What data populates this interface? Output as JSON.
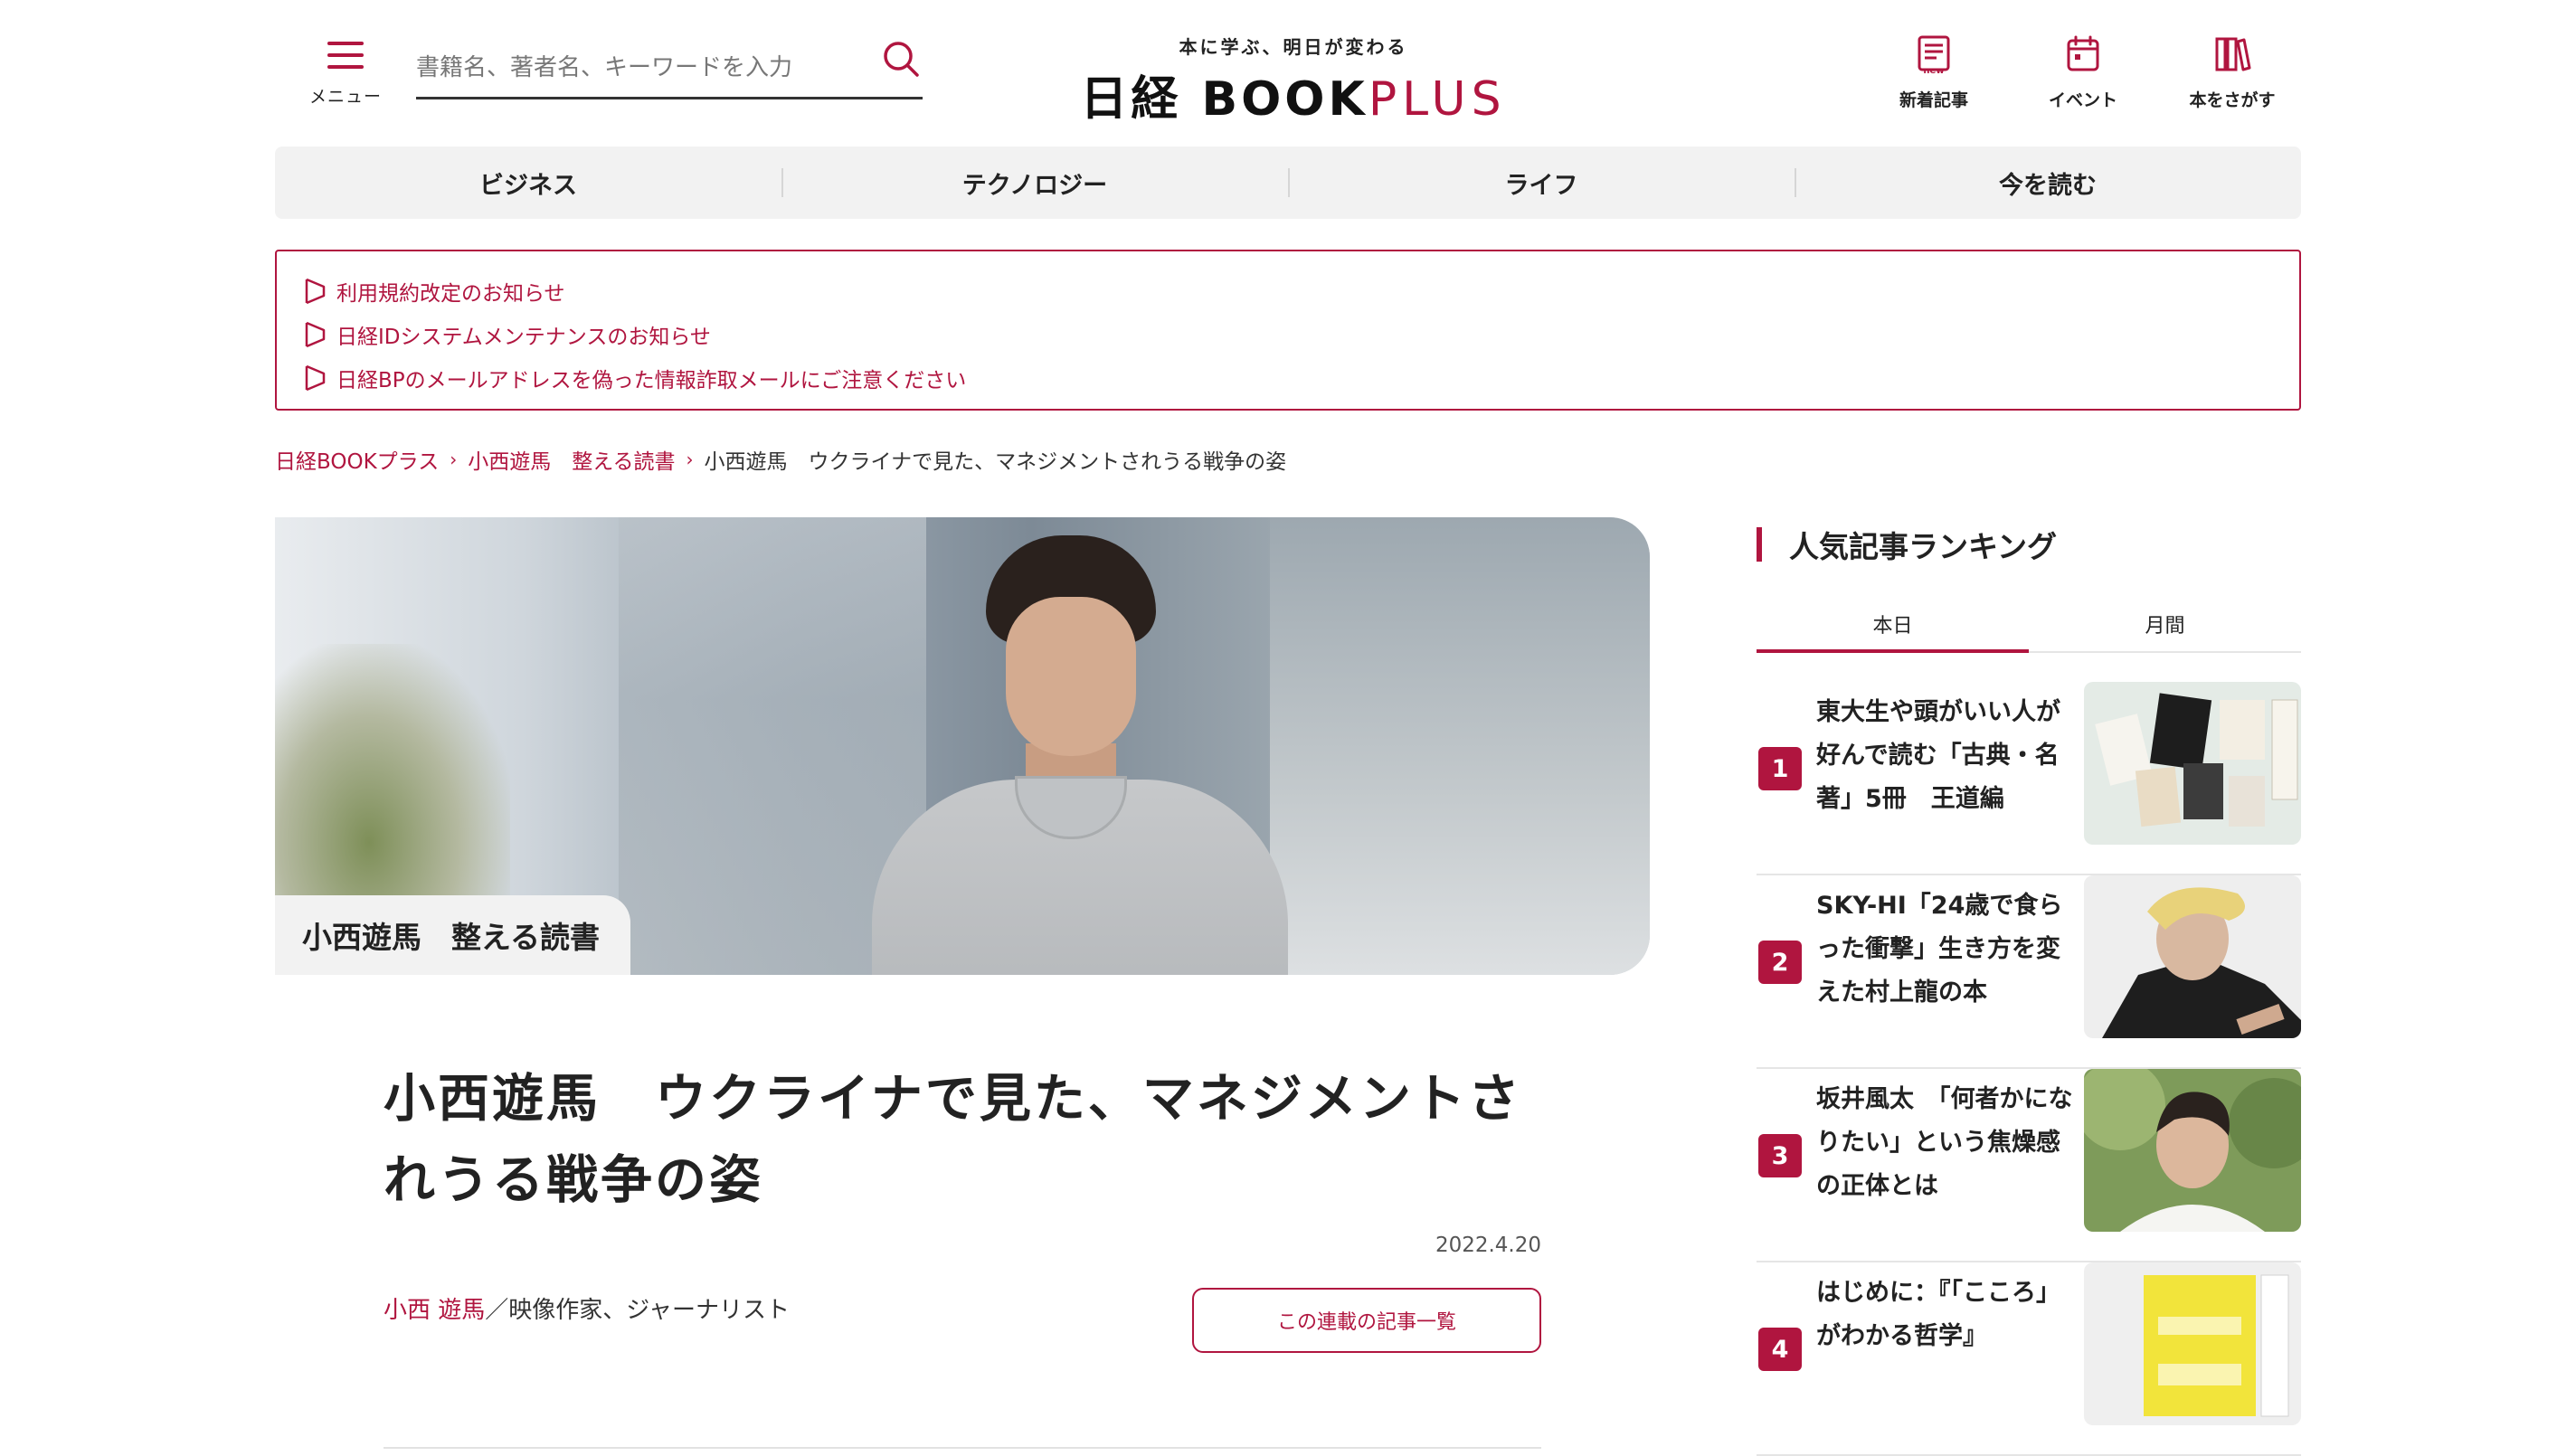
{
  "header": {
    "menu_label": "メニュー",
    "search_placeholder": "書籍名、著者名、キーワードを入力",
    "logo_tagline": "本に学ぶ、明日が変わる",
    "logo_name": "日経 BOOK",
    "logo_plus": "PLUS",
    "nav": [
      {
        "label": "新着記事",
        "icon": "new-articles-icon"
      },
      {
        "label": "イベント",
        "icon": "calendar-icon"
      },
      {
        "label": "本をさがす",
        "icon": "books-icon"
      }
    ]
  },
  "categories": [
    "ビジネス",
    "テクノロジー",
    "ライフ",
    "今を読む"
  ],
  "notices": [
    "利用規約改定のお知らせ",
    "日経IDシステムメンテナンスのお知らせ",
    "日経BPのメールアドレスを偽った情報詐取メールにご注意ください"
  ],
  "breadcrumb": {
    "items": [
      "日経BOOKプラス",
      "小西遊馬　整える読書"
    ],
    "current": "小西遊馬　ウクライナで見た、マネジメントされうる戦争の姿"
  },
  "hero": {
    "series_label": "小西遊馬　整える読書"
  },
  "article": {
    "title": "小西遊馬　ウクライナで見た、マネジメントされうる戦争の姿",
    "date": "2022.4.20",
    "author_name": "小西 遊馬",
    "author_role": "／映像作家、ジャーナリスト",
    "series_button": "この連載の記事一覧"
  },
  "ranking": {
    "title": "人気記事ランキング",
    "tabs": [
      "本日",
      "月間"
    ],
    "active_tab": "本日",
    "items": [
      {
        "rank": "1",
        "title": "東大生や頭がいい人が好んで読む「古典・名著」5冊　王道編"
      },
      {
        "rank": "2",
        "title": "SKY-HI「24歳で食らった衝撃」生き方を変えた村上龍の本"
      },
      {
        "rank": "3",
        "title": "坂井風太　「何者かになりたい」という焦燥感の正体とは"
      },
      {
        "rank": "4",
        "title": "はじめに：『「こころ」がわかる哲学』"
      }
    ]
  },
  "colors": {
    "accent": "#b0153f",
    "nav_background": "#f2f2f2"
  }
}
